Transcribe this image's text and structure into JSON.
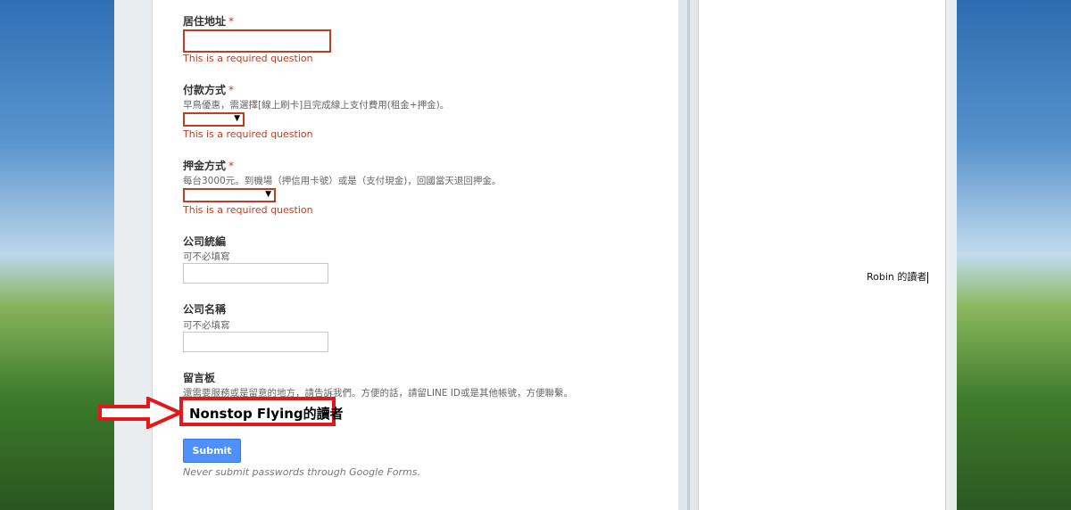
{
  "form": {
    "address": {
      "title": "居住地址",
      "required_mark": "*",
      "error": "This is a required question"
    },
    "payment": {
      "title": "付款方式",
      "required_mark": "*",
      "help": "早鳥優惠，需選擇[線上刷卡]且完成線上支付費用(租金+押金)。",
      "arrow": "▼",
      "error": "This is a required question"
    },
    "deposit": {
      "title": "押金方式",
      "required_mark": "*",
      "help": "每台3000元。到機場（押信用卡號）或是（支付現金)，回國當天退回押金。",
      "arrow": "▼",
      "error": "This is a required question"
    },
    "tax_id": {
      "title": "公司統編",
      "help": "可不必填寫"
    },
    "company_name": {
      "title": "公司名稱",
      "help": "可不必填寫"
    },
    "message": {
      "title": "留言板",
      "help": "還需要服務或是留意的地方，請告訴我們。方便的話，請留LINE ID或是其他帳號，方便聯繫。"
    },
    "submit_label": "Submit",
    "footnote": "Never submit passwords through Google Forms."
  },
  "annotation": {
    "highlight_text": "Nonstop Flying的讀者",
    "color": "#e4171b"
  },
  "side_doc": {
    "text": "Robin 的讀者"
  },
  "colors": {
    "error": "#c43b1d",
    "submit": "#4d90fe"
  }
}
